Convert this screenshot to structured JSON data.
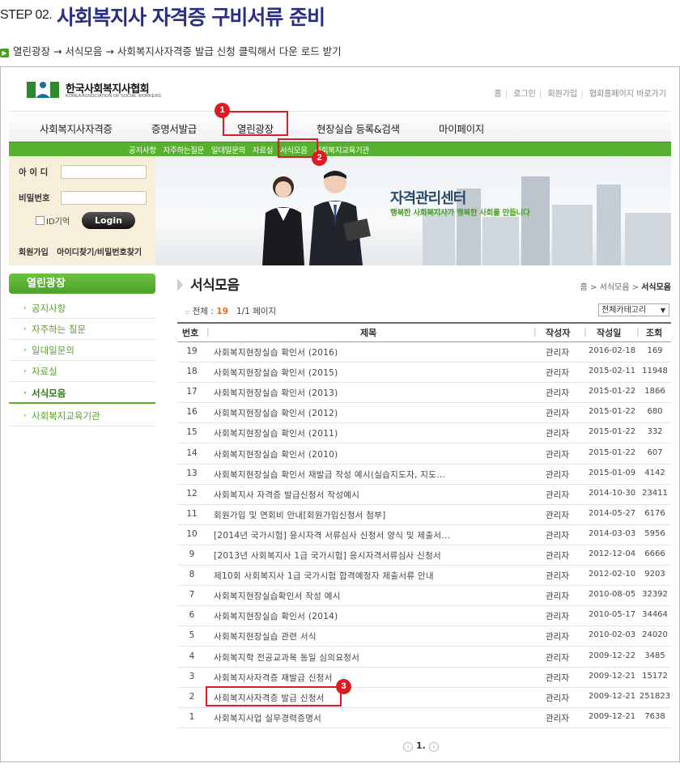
{
  "step": {
    "label": "STEP 02.",
    "title": "사회복지사 자격증 구비서류 준비",
    "instruction": "열린광장 → 서식모음 → 사회복지사자격증 발급 신청 클릭해서 다운 로드 받기"
  },
  "site": {
    "logo_ko": "한국사회복지사협회",
    "logo_en": "KOREA ASSOCIATION OF SOCIAL WORKERS",
    "top_links": [
      "홈",
      "로그인",
      "회원가입",
      "협회홈페이지 바로가기"
    ],
    "gnb": [
      "사회복지사자격증",
      "증명서발급",
      "열린광장",
      "현장실습 등록&검색",
      "마이페이지"
    ],
    "lnb": [
      "공지사항",
      "자주하는질문",
      "일대일문의",
      "자료실",
      "서식모음",
      "사회복지교육기관"
    ]
  },
  "login": {
    "id_label": "아 이 디",
    "pw_label": "비밀번호",
    "remember_label": "ID기억",
    "login_button": "Login",
    "join_link": "회원가입",
    "find_link": "아이디찾기/비밀번호찾기"
  },
  "banner": {
    "title": "자격관리센터",
    "subtitle": "행복한 사회복지사가 행복한 사회를 만듭니다"
  },
  "sidebar": {
    "title": "열린광장",
    "items": [
      "공지사항",
      "자주하는 질문",
      "일대일문의",
      "자료실",
      "서식모음",
      "사회복지교육기관"
    ]
  },
  "main": {
    "title": "서식모음",
    "breadcrumb_home": "홈",
    "breadcrumb_mid": "서식모음",
    "breadcrumb_current": "서식모음",
    "count_prefix": "전체 :",
    "count_value": "19",
    "page_info": "1/1 페이지",
    "category_select": "전체카테고리",
    "columns": [
      "번호",
      "제목",
      "작성자",
      "작성일",
      "조회"
    ],
    "rows": [
      {
        "no": "19",
        "title": "사회복지현장실습 확인서 (2016)",
        "author": "관리자",
        "date": "2016-02-18",
        "views": "169"
      },
      {
        "no": "18",
        "title": "사회복지현장실습 확인서 (2015)",
        "author": "관리자",
        "date": "2015-02-11",
        "views": "11948"
      },
      {
        "no": "17",
        "title": "사회복지현장실습 확인서 (2013)",
        "author": "관리자",
        "date": "2015-01-22",
        "views": "1866"
      },
      {
        "no": "16",
        "title": "사회복지현장실습 확인서 (2012)",
        "author": "관리자",
        "date": "2015-01-22",
        "views": "680"
      },
      {
        "no": "15",
        "title": "사회복지현장실습 확인서 (2011)",
        "author": "관리자",
        "date": "2015-01-22",
        "views": "332"
      },
      {
        "no": "14",
        "title": "사회복지현장실습 확인서 (2010)",
        "author": "관리자",
        "date": "2015-01-22",
        "views": "607"
      },
      {
        "no": "13",
        "title": "사회복지현장실습 확인서 재발급 작성 예시(실습지도자, 지도...",
        "author": "관리자",
        "date": "2015-01-09",
        "views": "4142"
      },
      {
        "no": "12",
        "title": "사회복지사 자격증 발급신청서 작성예시",
        "author": "관리자",
        "date": "2014-10-30",
        "views": "23411"
      },
      {
        "no": "11",
        "title": "회원가입 및 연회비 안내[회원가입신청서 첨부]",
        "author": "관리자",
        "date": "2014-05-27",
        "views": "6176"
      },
      {
        "no": "10",
        "title": "[2014년 국가시험] 응시자격 서류심사 신청서 양식 및 제출서...",
        "author": "관리자",
        "date": "2014-03-03",
        "views": "5956"
      },
      {
        "no": "9",
        "title": "[2013년 사회복지사 1급 국가시험] 응시자격서류심사 신청서",
        "author": "관리자",
        "date": "2012-12-04",
        "views": "6666"
      },
      {
        "no": "8",
        "title": "제10회 사회복지사 1급 국가시험 합격예정자 제출서류 안내",
        "author": "관리자",
        "date": "2012-02-10",
        "views": "9203"
      },
      {
        "no": "7",
        "title": "사회복지현장실습확인서 작성 예시",
        "author": "관리자",
        "date": "2010-08-05",
        "views": "32392"
      },
      {
        "no": "6",
        "title": "사회복지현장실습 확인서 (2014)",
        "author": "관리자",
        "date": "2010-05-17",
        "views": "34464"
      },
      {
        "no": "5",
        "title": "사회복지현장실습 관련 서식",
        "author": "관리자",
        "date": "2010-02-03",
        "views": "24020"
      },
      {
        "no": "4",
        "title": "사회복지학 전공교과목 동일 심의요청서",
        "author": "관리자",
        "date": "2009-12-22",
        "views": "3485"
      },
      {
        "no": "3",
        "title": "사회복지사자격증 재발급 신청서",
        "author": "관리자",
        "date": "2009-12-21",
        "views": "15172"
      },
      {
        "no": "2",
        "title": "사회복지사자격증 발급 신청서",
        "author": "관리자",
        "date": "2009-12-21",
        "views": "251823"
      },
      {
        "no": "1",
        "title": "사회복지사업 실무경력증명서",
        "author": "관리자",
        "date": "2009-12-21",
        "views": "7638"
      }
    ],
    "pager_current": "1."
  },
  "annotations": [
    "1",
    "2",
    "3"
  ],
  "colors": {
    "title_blue": "#2b2f84",
    "brand_green": "#57b02f",
    "annotation_red": "#e01a22",
    "count_orange": "#e26a1d"
  }
}
